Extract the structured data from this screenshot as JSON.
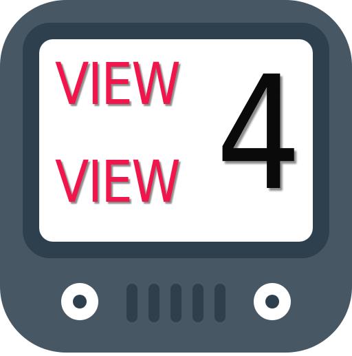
{
  "app_icon": {
    "screen": {
      "line1": "VIEW",
      "line2": "VIEW",
      "number": "4"
    },
    "colors": {
      "body": "#475764",
      "bezel": "#2e3f4e",
      "screen": "#ffffff",
      "text_red": "#f0154a",
      "text_black": "#0a0a0a",
      "speaker_slot": "#2f3f4d",
      "knob_ring": "#ffffff"
    },
    "icons": {
      "left_knob": "knob-icon",
      "right_knob": "knob-icon",
      "speaker": "speaker-grille-icon"
    }
  }
}
